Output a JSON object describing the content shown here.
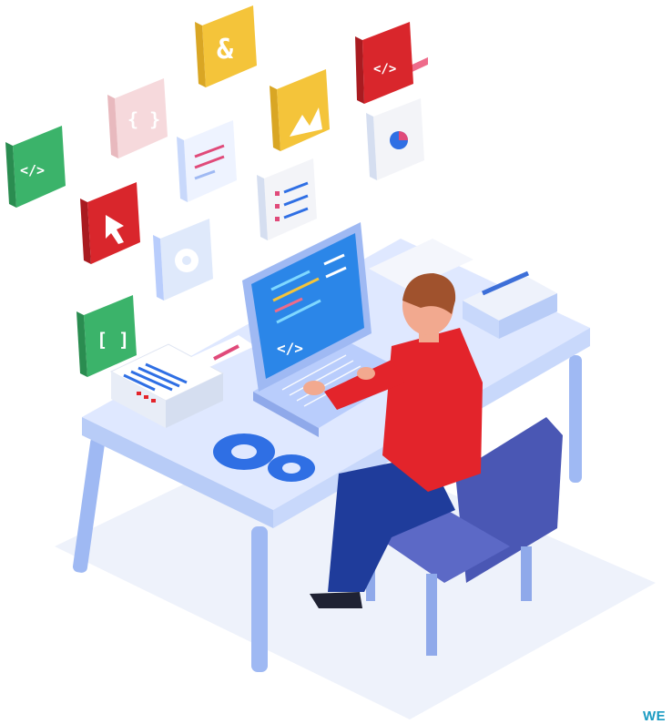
{
  "scene": {
    "subject": "developer working at a laptop on an isometric desk",
    "colors": {
      "desk": "#c8d8fb",
      "desk_top": "#dfe8ff",
      "legs": "#9fb9f3",
      "screen": "#2b86e8",
      "laptop_body": "#b9cdfc",
      "shirt": "#e3242b",
      "pants": "#1f3c9b",
      "chair": "#4a57b4",
      "hair": "#a0522d",
      "gears": "#2f6fe4",
      "shadow": "#eef2fb"
    }
  },
  "floating_tiles": [
    {
      "id": "ampersand",
      "icon": "ampersand-icon",
      "glyph": "&",
      "color": "#f4c43a"
    },
    {
      "id": "code-red",
      "icon": "code-icon",
      "glyph": "</>",
      "color": "#d9262c"
    },
    {
      "id": "braces",
      "icon": "braces-icon",
      "glyph": "{ }",
      "color": "#f6d9dc"
    },
    {
      "id": "image",
      "icon": "image-icon",
      "glyph": "",
      "color": "#f4c43a"
    },
    {
      "id": "code-green",
      "icon": "code-icon",
      "glyph": "</>",
      "color": "#3bb36a"
    },
    {
      "id": "document",
      "icon": "document-icon",
      "glyph": "",
      "color": "#eef3ff"
    },
    {
      "id": "chart",
      "icon": "pie-chart-icon",
      "glyph": "",
      "color": "#f3f4f8"
    },
    {
      "id": "list",
      "icon": "list-icon",
      "glyph": "",
      "color": "#f3f4f8"
    },
    {
      "id": "cursor",
      "icon": "cursor-icon",
      "glyph": "",
      "color": "#d9262c"
    },
    {
      "id": "gear",
      "icon": "gear-icon",
      "glyph": "",
      "color": "#dfe9fb"
    },
    {
      "id": "brackets",
      "icon": "brackets-icon",
      "glyph": "[ ]",
      "color": "#3bb36a"
    }
  ],
  "laptop_screen": {
    "glyph": "</>"
  },
  "watermark": {
    "text": "WE"
  }
}
